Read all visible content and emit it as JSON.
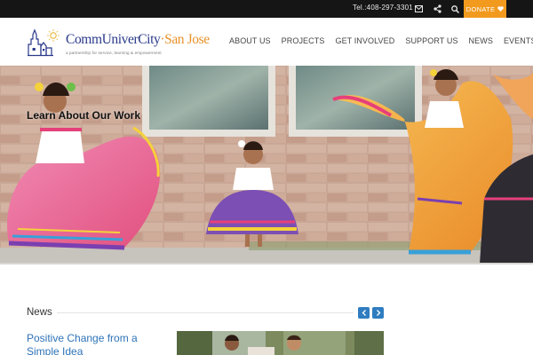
{
  "topbar": {
    "phone": "Tel.:408-297-3301",
    "icons": [
      "email-icon",
      "share-icon",
      "search-icon"
    ],
    "donate_label": "DONATE",
    "donate_icon": "heart-icon",
    "colors": {
      "bar": "#151515",
      "donate": "#f29a1e"
    }
  },
  "header": {
    "logo": {
      "name_part1": "CommUniverCity",
      "separator": "·",
      "name_part2": "San Jose",
      "tagline": "a partnership for service, learning & empowerment"
    },
    "nav": [
      {
        "label": "ABOUT US"
      },
      {
        "label": "PROJECTS"
      },
      {
        "label": "GET INVOLVED"
      },
      {
        "label": "SUPPORT US"
      },
      {
        "label": "NEWS"
      },
      {
        "label": "EVENTS"
      }
    ]
  },
  "hero": {
    "title": "Learn About Our Work"
  },
  "news": {
    "heading": "News",
    "prev_icon": "chevron-left-icon",
    "next_icon": "chevron-right-icon",
    "items": [
      {
        "title": "Positive Change from a Simple Idea"
      }
    ],
    "colors": {
      "link": "#2e73b8",
      "arrow": "#2f7dc0"
    }
  }
}
